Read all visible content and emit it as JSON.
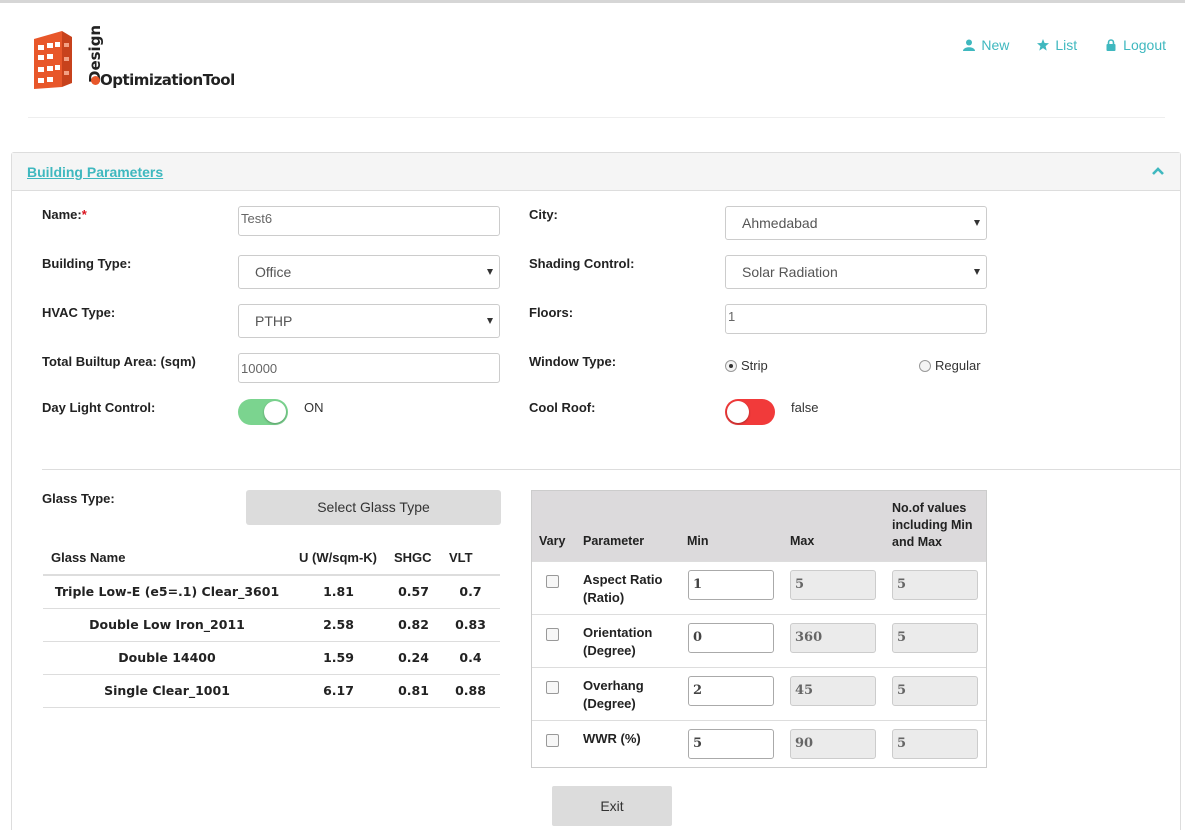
{
  "brand": {
    "logo_top": "Design",
    "logo_main": "OptimizationTool"
  },
  "nav": [
    {
      "label": "New",
      "icon": "user-icon"
    },
    {
      "label": "List",
      "icon": "star-icon"
    },
    {
      "label": "Logout",
      "icon": "lock-icon"
    }
  ],
  "accent_color": "#3fb8bf",
  "panel": {
    "title": "Building Parameters"
  },
  "form": {
    "name_label": "Name:",
    "name_required": "*",
    "name_value": "Test6",
    "building_type_label": "Building Type:",
    "building_type_value": "Office",
    "hvac_label": "HVAC Type:",
    "hvac_value": "PTHP",
    "area_label": "Total Builtup Area: (sqm)",
    "area_value": "10000",
    "daylight_label": "Day Light Control:",
    "daylight_value": "ON",
    "city_label": "City:",
    "city_value": "Ahmedabad",
    "shading_label": "Shading Control:",
    "shading_value": "Solar Radiation",
    "floors_label": "Floors:",
    "floors_value": "1",
    "window_label": "Window Type:",
    "window_options": [
      "Strip",
      "Regular"
    ],
    "window_selected": "Strip",
    "coolroof_label": "Cool Roof:",
    "coolroof_value": "false"
  },
  "glass": {
    "label": "Glass Type:",
    "button": "Select Glass Type",
    "columns": [
      "Glass Name",
      "U (W/sqm-K)",
      "SHGC",
      "VLT"
    ],
    "rows": [
      [
        "Triple Low-E (e5=.1) Clear_3601",
        "1.81",
        "0.57",
        "0.7"
      ],
      [
        "Double Low Iron_2011",
        "2.58",
        "0.82",
        "0.83"
      ],
      [
        "Double 14400",
        "1.59",
        "0.24",
        "0.4"
      ],
      [
        "Single Clear_1001",
        "6.17",
        "0.81",
        "0.88"
      ]
    ]
  },
  "params": {
    "columns": [
      "Vary",
      "Parameter",
      "Min",
      "Max",
      "No.of values including Min and Max"
    ],
    "rows": [
      {
        "name": "Aspect Ratio",
        "unit": "(Ratio)",
        "min": "1",
        "max": "5",
        "count": "5"
      },
      {
        "name": "Orientation",
        "unit": "(Degree)",
        "min": "0",
        "max": "360",
        "count": "5"
      },
      {
        "name": "Overhang",
        "unit": "(Degree)",
        "min": "2",
        "max": "45",
        "count": "5"
      },
      {
        "name": "WWR (%)",
        "unit": "",
        "min": "5",
        "max": "90",
        "count": "5"
      }
    ]
  },
  "exit_label": "Exit"
}
